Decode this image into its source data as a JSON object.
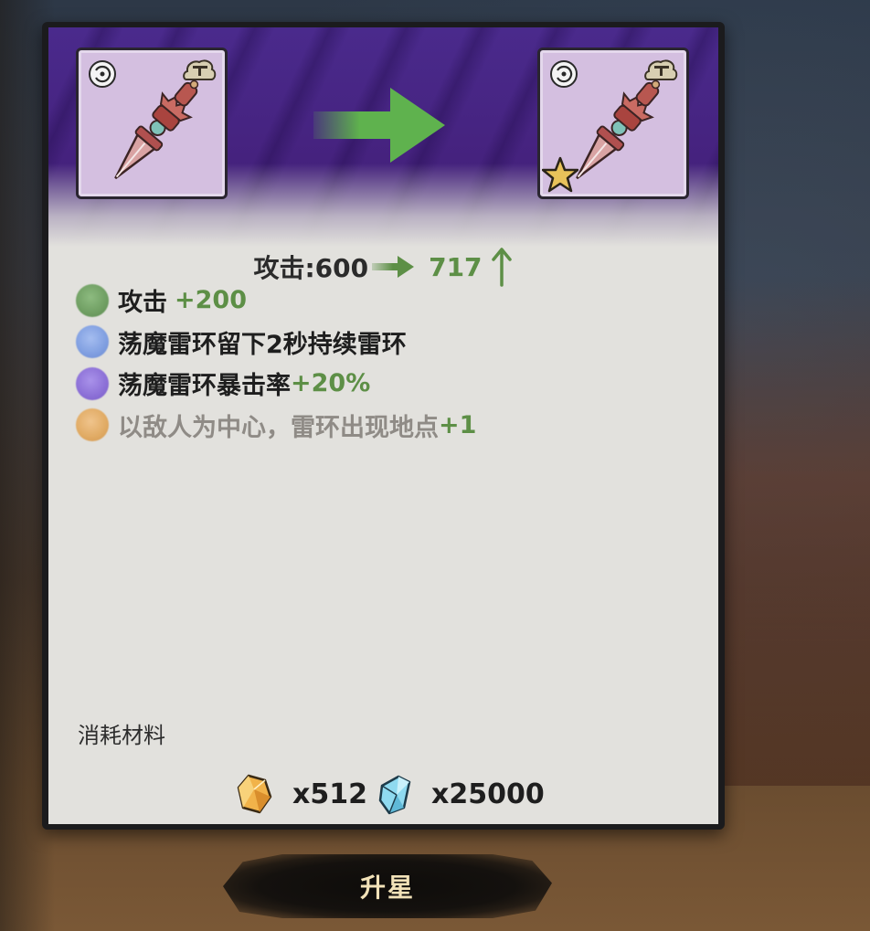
{
  "stat": {
    "old": "攻击:600",
    "new": "717"
  },
  "bonuses": [
    {
      "label": "攻击",
      "value": "+200",
      "dot_color": "#6f9e62"
    },
    {
      "label": "荡魔雷环留下2秒持续雷环",
      "value": "",
      "dot_color": "#7f9ee0"
    },
    {
      "label": "荡魔雷环暴击率",
      "value": "+20%",
      "dot_color": "#8b6fd6"
    },
    {
      "label": "以敌人为中心，雷环出现地点",
      "value": "+1",
      "dot_color": "#e0aa63"
    }
  ],
  "materials": {
    "label": "消耗材料",
    "amber_crystal_qty": "x512",
    "blue_crystal_qty": "x25000"
  },
  "button": {
    "label": "升星"
  },
  "colors": {
    "banner": "#45227e",
    "card": "#d4bfe0",
    "bonus_value": "#5d8f46",
    "arrow": "#5fb24e"
  },
  "icons": [
    "spiral-icon",
    "bell-icon",
    "dagger-weapon-icon",
    "star-icon",
    "right-arrow-icon",
    "up-arrow-icon",
    "amber-crystal-icon",
    "blue-crystal-icon"
  ]
}
